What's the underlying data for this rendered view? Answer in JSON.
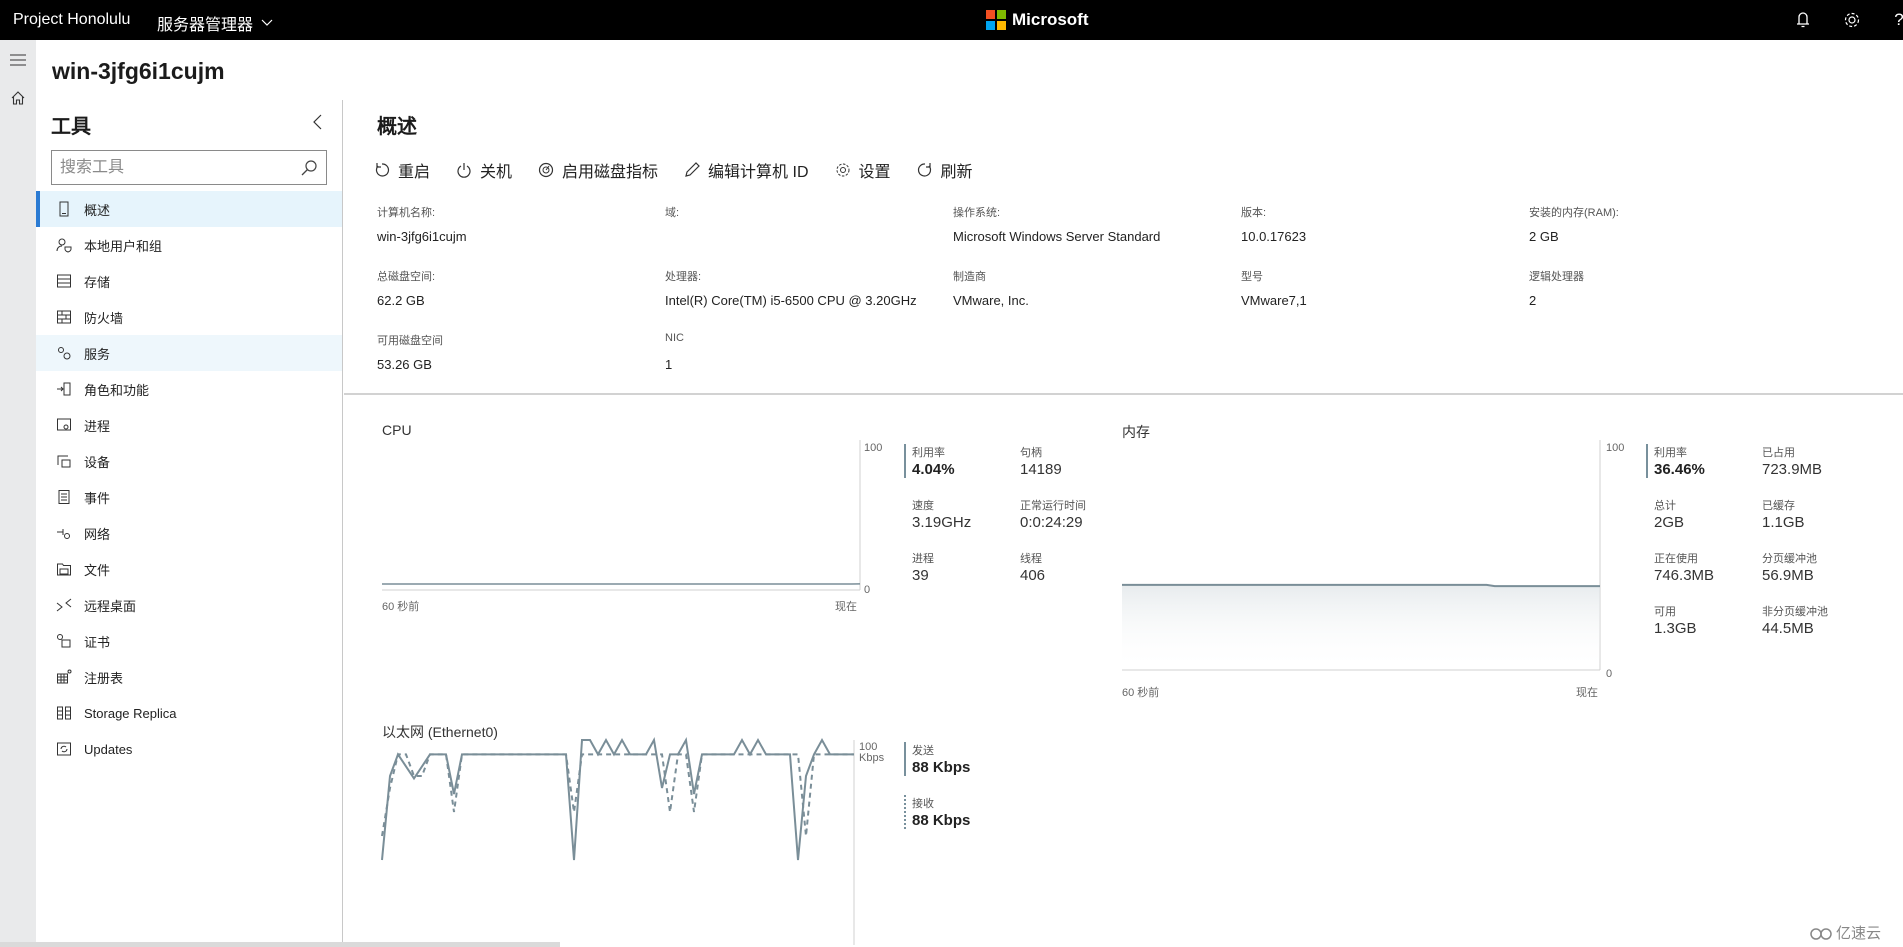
{
  "topbar": {
    "brand": "Project Honolulu",
    "app_menu": "服务器管理器",
    "center_brand": "Microsoft",
    "ms_logo_colors": [
      "#f25022",
      "#7fba00",
      "#00a4ef",
      "#ffb900"
    ],
    "icons": [
      "bell-icon",
      "gear-icon",
      "help-icon"
    ]
  },
  "server": {
    "name": "win-3jfg6i1cujm"
  },
  "tools": {
    "title": "工具",
    "search_placeholder": "搜索工具",
    "items": [
      {
        "label": "概述",
        "icon": "device-icon",
        "state": "active"
      },
      {
        "label": "本地用户和组",
        "icon": "users-icon"
      },
      {
        "label": "存储",
        "icon": "storage-icon"
      },
      {
        "label": "防火墙",
        "icon": "firewall-icon"
      },
      {
        "label": "服务",
        "icon": "services-icon",
        "state": "hover"
      },
      {
        "label": "角色和功能",
        "icon": "roles-icon"
      },
      {
        "label": "进程",
        "icon": "processes-icon"
      },
      {
        "label": "设备",
        "icon": "devices-icon"
      },
      {
        "label": "事件",
        "icon": "events-icon"
      },
      {
        "label": "网络",
        "icon": "network-icon"
      },
      {
        "label": "文件",
        "icon": "files-icon"
      },
      {
        "label": "远程桌面",
        "icon": "remote-desktop-icon"
      },
      {
        "label": "证书",
        "icon": "certificate-icon"
      },
      {
        "label": "注册表",
        "icon": "registry-icon"
      },
      {
        "label": "Storage Replica",
        "icon": "storage-replica-icon"
      },
      {
        "label": "Updates",
        "icon": "updates-icon"
      }
    ]
  },
  "overview": {
    "title": "概述",
    "actions": [
      {
        "label": "重启",
        "icon": "restart-icon"
      },
      {
        "label": "关机",
        "icon": "power-icon"
      },
      {
        "label": "启用磁盘指标",
        "icon": "gauge-icon"
      },
      {
        "label": "编辑计算机 ID",
        "icon": "pencil-icon"
      },
      {
        "label": "设置",
        "icon": "gear-icon"
      },
      {
        "label": "刷新",
        "icon": "refresh-icon"
      }
    ],
    "properties": [
      {
        "key": "计算机名称:",
        "value": "win-3jfg6i1cujm"
      },
      {
        "key": "域:",
        "value": ""
      },
      {
        "key": "操作系统:",
        "value": "Microsoft Windows Server Standard"
      },
      {
        "key": "版本:",
        "value": "10.0.17623"
      },
      {
        "key": "安装的内存(RAM):",
        "value": "2 GB"
      },
      {
        "key": "总磁盘空间:",
        "value": "62.2 GB"
      },
      {
        "key": "处理器:",
        "value": "Intel(R) Core(TM) i5-6500 CPU @ 3.20GHz"
      },
      {
        "key": "制造商",
        "value": "VMware, Inc."
      },
      {
        "key": "型号",
        "value": "VMware7,1"
      },
      {
        "key": "逻辑处理器",
        "value": "2"
      },
      {
        "key": "可用磁盘空间",
        "value": "53.26 GB"
      },
      {
        "key": "NIC",
        "value": "1"
      }
    ]
  },
  "cpu": {
    "title": "CPU",
    "y_max_label": "100",
    "y_min_label": "0",
    "x_start_label": "60 秒前",
    "x_end_label": "现在",
    "stats": [
      {
        "key": "利用率",
        "value": "4.04%"
      },
      {
        "key": "句柄",
        "value": "14189"
      },
      {
        "key": "速度",
        "value": "3.19GHz"
      },
      {
        "key": "正常运行时间",
        "value": "0:0:24:29"
      },
      {
        "key": "进程",
        "value": "39"
      },
      {
        "key": "线程",
        "value": "406"
      }
    ]
  },
  "memory": {
    "title": "内存",
    "y_max_label": "100",
    "y_min_label": "0",
    "x_start_label": "60 秒前",
    "x_end_label": "现在",
    "stats": [
      {
        "key": "利用率",
        "value": "36.46%"
      },
      {
        "key": "已占用",
        "value": "723.9MB"
      },
      {
        "key": "总计",
        "value": "2GB"
      },
      {
        "key": "已缓存",
        "value": "1.1GB"
      },
      {
        "key": "正在使用",
        "value": "746.3MB"
      },
      {
        "key": "分页缓冲池",
        "value": "56.9MB"
      },
      {
        "key": "可用",
        "value": "1.3GB"
      },
      {
        "key": "非分页缓冲池",
        "value": "44.5MB"
      }
    ]
  },
  "network": {
    "title": "以太网 (Ethernet0)",
    "y_max_label": "100",
    "y_unit_label": "Kbps",
    "stats": [
      {
        "key": "发送",
        "value": "88 Kbps"
      },
      {
        "key": "接收",
        "value": "88 Kbps"
      }
    ]
  },
  "watermark": "亿速云",
  "chart_data": [
    {
      "type": "line",
      "title": "CPU",
      "xlabel": "",
      "ylabel": "",
      "x_tick_labels": [
        "60 秒前",
        "现在"
      ],
      "ylim": [
        0,
        100
      ],
      "series": [
        {
          "name": "利用率",
          "values": [
            4,
            4,
            4,
            4,
            4,
            4,
            4,
            4,
            4,
            4,
            4,
            4,
            4,
            4,
            4,
            4,
            4,
            4,
            4,
            4,
            4,
            4,
            4,
            4,
            4,
            4,
            4,
            4,
            4,
            4,
            4,
            4,
            4,
            4,
            4,
            4,
            4,
            4,
            4,
            4,
            4,
            4,
            4,
            4,
            4,
            4,
            4,
            4,
            4,
            4,
            4,
            4,
            4,
            4,
            4,
            4,
            4,
            4,
            4,
            4.04
          ]
        }
      ]
    },
    {
      "type": "area",
      "title": "内存",
      "xlabel": "",
      "ylabel": "",
      "x_tick_labels": [
        "60 秒前",
        "现在"
      ],
      "ylim": [
        0,
        100
      ],
      "series": [
        {
          "name": "利用率",
          "values": [
            37,
            37,
            37,
            37,
            37,
            37,
            37,
            37,
            37,
            37,
            37,
            37,
            37,
            37,
            37,
            37,
            37,
            37,
            37,
            37,
            37,
            37,
            37,
            37,
            37,
            37,
            37,
            37,
            37,
            37,
            37,
            37,
            37,
            37,
            37,
            37,
            37,
            37,
            37,
            37,
            37,
            37,
            37,
            37,
            37,
            37,
            36.5,
            36.5,
            36.5,
            36.5,
            36.5,
            36.5,
            36.5,
            36.5,
            36.5,
            36.5,
            36.5,
            36.5,
            36.5,
            36.46
          ]
        }
      ]
    },
    {
      "type": "line",
      "title": "以太网 (Ethernet0)",
      "xlabel": "",
      "ylabel": "Kbps",
      "ylim": [
        0,
        100
      ],
      "series": [
        {
          "name": "发送",
          "style": "solid",
          "values": [
            0,
            70,
            88,
            78,
            68,
            78,
            88,
            88,
            88,
            55,
            88,
            88,
            88,
            88,
            88,
            88,
            88,
            88,
            88,
            88,
            88,
            88,
            88,
            88,
            0,
            100,
            100,
            88,
            100,
            88,
            100,
            88,
            88,
            88,
            100,
            60,
            88,
            88,
            100,
            55,
            88,
            88,
            88,
            88,
            88,
            100,
            88,
            100,
            88,
            88,
            88,
            88,
            0,
            70,
            88,
            100,
            88,
            88,
            88,
            88
          ]
        },
        {
          "name": "接收",
          "style": "dashed",
          "values": [
            20,
            60,
            88,
            88,
            70,
            70,
            88,
            88,
            88,
            40,
            88,
            88,
            88,
            88,
            88,
            88,
            88,
            88,
            88,
            88,
            88,
            88,
            88,
            88,
            40,
            88,
            88,
            88,
            88,
            88,
            88,
            88,
            88,
            88,
            88,
            88,
            40,
            88,
            88,
            40,
            88,
            88,
            88,
            88,
            88,
            88,
            88,
            88,
            88,
            88,
            88,
            88,
            88,
            20,
            88,
            88,
            88,
            88,
            88,
            88
          ]
        }
      ]
    }
  ]
}
